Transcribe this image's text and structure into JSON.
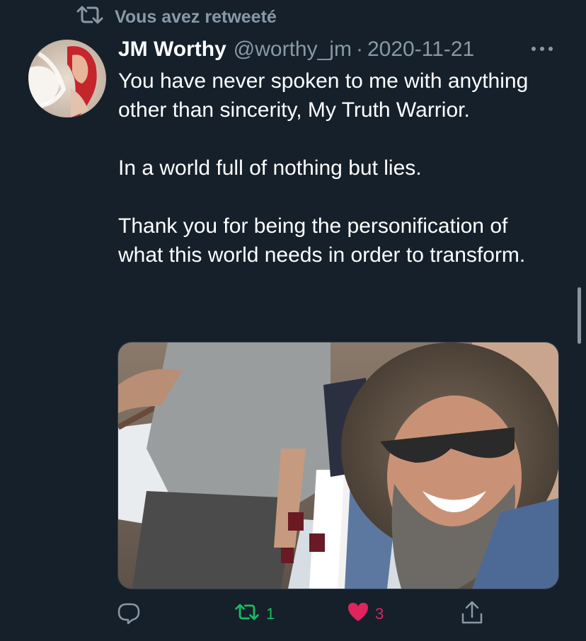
{
  "retweet_context": {
    "text": "Vous avez retweeté",
    "icon": "retweet-icon"
  },
  "tweet": {
    "author": {
      "display_name": "JM Worthy",
      "handle": "@worthy_jm",
      "separator": "·",
      "avatar_desc": "avatar"
    },
    "date": "2020-11-21",
    "text": [
      "You have never spoken to me with anything other than sincerity, My Truth Warrior.",
      "In a world full of nothing but lies.",
      "Thank you for being the personification of what this world needs in order to transform."
    ],
    "actions": {
      "reply": {
        "icon": "reply-icon",
        "count": ""
      },
      "retweet": {
        "icon": "retweet-icon",
        "count": "1",
        "color": "#17bf63"
      },
      "like": {
        "icon": "heart-icon",
        "count": "3",
        "color": "#e0245e"
      },
      "share": {
        "icon": "share-icon"
      }
    }
  },
  "colors": {
    "background": "#15202b",
    "secondary_text": "#8899a6",
    "primary_text": "#ffffff"
  }
}
